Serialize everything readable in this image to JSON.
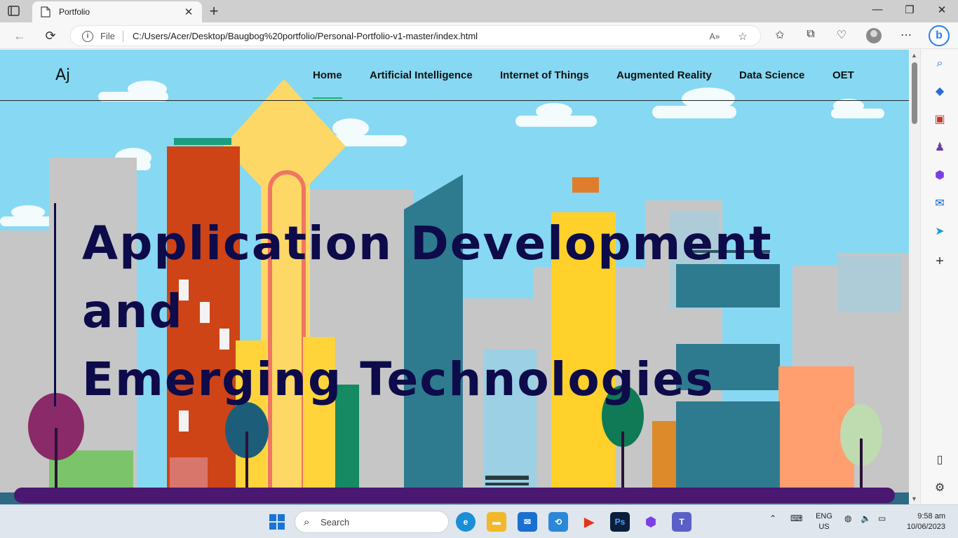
{
  "browser": {
    "tab_title": "Portfolio",
    "tab_close": "✕",
    "new_tab": "+",
    "address": {
      "scheme_label": "File",
      "url": "C:/Users/Acer/Desktop/Baugbog%20portfolio/Personal-Portfolio-v1-master/index.html"
    },
    "window_controls": {
      "minimize": "—",
      "maximize": "❐",
      "close": "✕"
    }
  },
  "site": {
    "logo": "Aj",
    "nav": [
      "Home",
      "Artificial Intelligence",
      "Internet of Things",
      "Augmented Reality",
      "Data Science",
      "OET"
    ],
    "active_nav": "Home",
    "hero_lines": [
      "Application Development",
      "and",
      "Emerging Technologies"
    ],
    "colors": {
      "sky": "#87d8f2",
      "hero_text": "#0d0b4a",
      "active_underline": "#12b76a",
      "ground": "#4a1870"
    }
  },
  "taskbar": {
    "search_placeholder": "Search",
    "language": {
      "line1": "ENG",
      "line2": "US"
    },
    "time": "9:58 am",
    "date": "10/06/2023"
  }
}
